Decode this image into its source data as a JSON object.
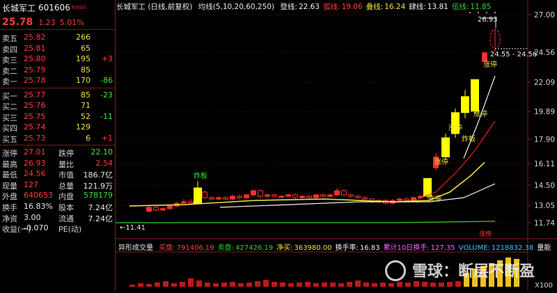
{
  "stock": {
    "name": "长城军工",
    "code": "601606",
    "tag": "R/000",
    "price": "25.78",
    "change": "1.23",
    "pct": "5.01%"
  },
  "asks": [
    {
      "label": "卖五",
      "price": "25.82",
      "vol": "266",
      "delta": ""
    },
    {
      "label": "卖四",
      "price": "25.81",
      "vol": "65",
      "delta": ""
    },
    {
      "label": "卖三",
      "price": "25.80",
      "vol": "195",
      "delta": "+3"
    },
    {
      "label": "卖二",
      "price": "25.79",
      "vol": "85",
      "delta": ""
    },
    {
      "label": "卖一",
      "price": "25.78",
      "vol": "170",
      "delta": "-86"
    }
  ],
  "bids": [
    {
      "label": "买一",
      "price": "25.77",
      "vol": "85",
      "delta": "-23"
    },
    {
      "label": "买二",
      "price": "25.76",
      "vol": "71",
      "delta": ""
    },
    {
      "label": "买三",
      "price": "25.75",
      "vol": "52",
      "delta": "-11"
    },
    {
      "label": "买四",
      "price": "25.74",
      "vol": "129",
      "delta": ""
    },
    {
      "label": "买五",
      "price": "25.73",
      "vol": "6",
      "delta": "+1"
    }
  ],
  "stats": [
    {
      "a": "涨停",
      "b": "27.01",
      "bc": "red",
      "c": "跌停",
      "d": "22.10",
      "dc": "grn"
    },
    {
      "a": "最高",
      "b": "26.93",
      "bc": "red",
      "c": "量比",
      "d": "2.54",
      "dc": "red"
    },
    {
      "a": "最低",
      "b": "24.56",
      "bc": "red",
      "c": "市值",
      "d": "186.7亿",
      "dc": "wht"
    },
    {
      "a": "现量",
      "b": "127",
      "bc": "red",
      "c": "总量",
      "d": "121.9万",
      "dc": "wht"
    },
    {
      "a": "外盘",
      "b": "640653",
      "bc": "red",
      "c": "内盘",
      "d": "578179",
      "dc": "grn"
    },
    {
      "a": "换手",
      "b": "16.83%",
      "bc": "wht",
      "c": "股本",
      "d": "7.24亿",
      "dc": "wht"
    },
    {
      "a": "净资",
      "b": "3.00",
      "bc": "wht",
      "c": "流通",
      "d": "7.24亿",
      "dc": "wht"
    },
    {
      "a": "收益(一)",
      "b": "-0.070",
      "bc": "wht",
      "c": "PE(动)",
      "d": "",
      "dc": "wht"
    }
  ],
  "ma_header": {
    "title": "长城军工 (日线,前复权)",
    "ma": "均线(5,10,20,60,250)",
    "items": [
      {
        "k": "登线:",
        "v": "22.63",
        "color": "#f0f0f0"
      },
      {
        "k": "弧线:",
        "v": "19.06",
        "color": "#ff4040"
      },
      {
        "k": "叠线:",
        "v": "16.24",
        "color": "#f0e040"
      },
      {
        "k": "肆线:",
        "v": "13.81",
        "color": "#f0f0f0"
      },
      {
        "k": "伍线:",
        "v": "11.85",
        "color": "#30d030"
      }
    ]
  },
  "axis_labels": [
    "27.00",
    "24.56",
    "22.09",
    "19.89",
    "17.90",
    "16.11",
    "14.50",
    "13.05",
    "11.74"
  ],
  "annotations": {
    "high": "26.93",
    "low": "11.41",
    "range": "24.55 - 24.56",
    "zhaban": "炸板",
    "zhangting": "涨停",
    "zhangbang": "涨榜"
  },
  "vol_header": {
    "title": "异形成交量",
    "items": [
      {
        "k": "买盘:",
        "v": "791406.19",
        "color": "#ff4040"
      },
      {
        "k": "卖盘:",
        "v": "427426.19",
        "color": "#30d030"
      },
      {
        "k": "净买:",
        "v": "363980.00",
        "color": "#f0e040"
      },
      {
        "k": "换手率:",
        "v": "16.83",
        "color": "#f0f0f0"
      },
      {
        "k": "累计10日换手:",
        "v": "127.35",
        "color": "#ff60ff"
      },
      {
        "k": "VOLUME:",
        "v": "1218832.38",
        "color": "#40c0ff"
      },
      {
        "k": "量能",
        "v": "",
        "color": "#f0f0f0"
      }
    ]
  },
  "vol_axis_unit": "X100",
  "watermark": "雪球：断层不断盈"
}
